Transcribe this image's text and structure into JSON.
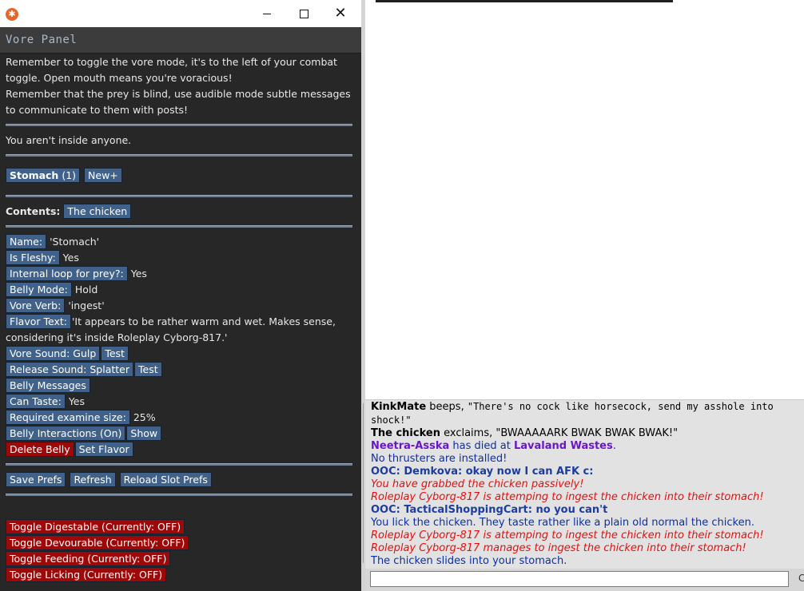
{
  "window": {
    "app_icon": "ss13-logo-icon",
    "panel_title": "Vore Panel",
    "controls": {
      "minimize": "minimize-icon",
      "maximize": "maximize-icon",
      "close": "close-icon",
      "close_glyph": "✕"
    }
  },
  "intro": {
    "line1": "Remember to toggle the vore mode, it's to the left of your combat toggle. Open mouth means you're voracious!",
    "line2": "Remember that the prey is blind, use audible mode subtle messages to communicate to them with posts!"
  },
  "inside_status": "You aren't inside anyone.",
  "bellies": {
    "tab_name": "Stomach",
    "tab_count": "(1)",
    "new_button": "New+"
  },
  "contents": {
    "label": "Contents:",
    "items": [
      "The chicken"
    ]
  },
  "belly": {
    "name": {
      "label": "Name:",
      "value": "'Stomach'"
    },
    "is_fleshy": {
      "label": "Is Fleshy:",
      "value": "Yes"
    },
    "internal_loop": {
      "label": "Internal loop for prey?:",
      "value": "Yes"
    },
    "belly_mode": {
      "label": "Belly Mode:",
      "value": "Hold"
    },
    "vore_verb": {
      "label": "Vore Verb:",
      "value": "'ingest'"
    },
    "flavor_text": {
      "label": "Flavor Text:",
      "value": "'It appears to be rather warm and wet. Makes sense, considering it's inside Roleplay Cyborg-817.'"
    },
    "vore_sound": {
      "label": "Vore Sound: Gulp",
      "test": "Test"
    },
    "release_sound": {
      "label": "Release Sound: Splatter",
      "test": "Test"
    },
    "belly_messages": "Belly Messages",
    "can_taste": {
      "label": "Can Taste:",
      "value": "Yes"
    },
    "examine_size": {
      "label": "Required examine size:",
      "value": "25%"
    },
    "interactions": {
      "label": "Belly Interactions (On)",
      "show": "Show"
    },
    "delete": "Delete Belly",
    "set_flavor": "Set Flavor"
  },
  "prefs": {
    "save": "Save Prefs",
    "refresh": "Refresh",
    "reload": "Reload Slot Prefs"
  },
  "toggles": [
    "Toggle Digestable (Currently: OFF)",
    "Toggle Devourable (Currently: OFF)",
    "Toggle Feeding (Currently: OFF)",
    "Toggle Licking (Currently: OFF)"
  ],
  "chat": {
    "l1_name": "KinkMate",
    "l1_verb": " beeps, ",
    "l1_text": "\"There's no cock like horsecock, send my asshole into shock!\"",
    "l2_name": "The chicken",
    "l2_rest": " exclaims, \"BWAAAAARK BWAK BWAK BWAK!\"",
    "l3_name": "Neetra-Asska",
    "l3_mid": " has died at ",
    "l3_place": "Lavaland Wastes",
    "l3_end": ".",
    "l4": "No thrusters are installed!",
    "l5": "OOC: Demkova: okay now I can AFK c:",
    "l6": "You have grabbed the chicken passively!",
    "l7": "Roleplay Cyborg-817 is attemping to ingest the chicken into their stomach!",
    "l8": "OOC: TacticalShoppingCart: no you can't",
    "l9": "You lick the chicken. They taste rather like a plain old normal the chicken.",
    "l10": "Roleplay Cyborg-817 is attemping to ingest the chicken into their stomach!",
    "l11": "Roleplay Cyborg-817 manages to ingest the chicken into their stomach!",
    "l12": "The chicken slides into your stomach.",
    "input_value": "",
    "input_edge": "C"
  }
}
